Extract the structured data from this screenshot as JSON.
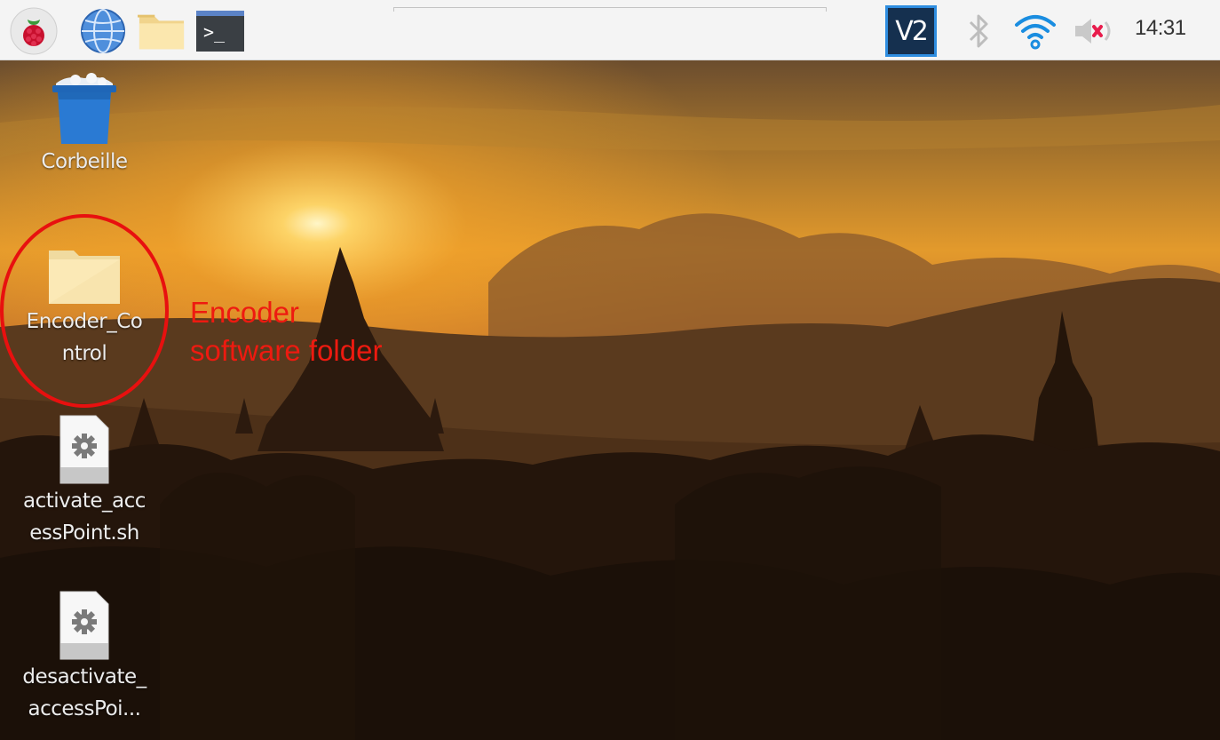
{
  "taskbar": {
    "launchers": [
      {
        "name": "raspberry-menu",
        "icon": "raspberry-icon"
      },
      {
        "name": "web-browser",
        "icon": "globe-icon"
      },
      {
        "name": "file-manager",
        "icon": "folder-icon"
      },
      {
        "name": "terminal",
        "icon": "terminal-icon",
        "glyph": ">_"
      }
    ],
    "tray": {
      "vnc_label": "V2",
      "bluetooth_icon": "bluetooth-icon",
      "wifi_icon": "wifi-icon",
      "volume_icon": "volume-muted-icon",
      "clock": "14:31"
    }
  },
  "desktop": {
    "icons": [
      {
        "label": "Corbeille",
        "icon": "trash-icon"
      },
      {
        "label": "Encoder_Co\nntrol",
        "icon": "folder-icon"
      },
      {
        "label": "activate_acc\nessPoint.sh",
        "icon": "script-file-icon"
      },
      {
        "label": "desactivate_\naccessPoi...",
        "icon": "script-file-icon"
      }
    ]
  },
  "annotation": {
    "text_line1": "Encoder",
    "text_line2": "software folder",
    "color": "#e8100f"
  },
  "colors": {
    "taskbar_bg": "#f4f4f4",
    "vnc_blue": "#1f5fae",
    "wifi_blue": "#1a8de0",
    "sky_orange": "#f2a12a"
  }
}
